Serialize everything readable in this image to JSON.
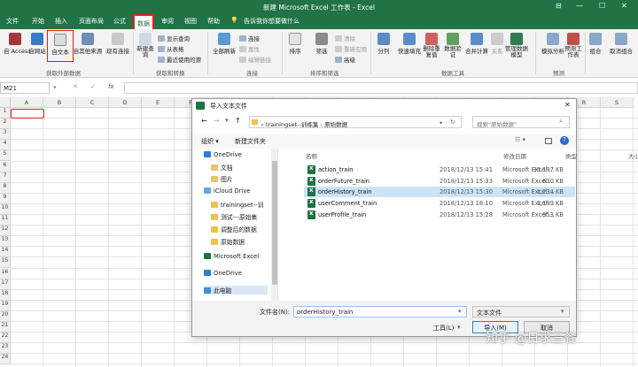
{
  "window": {
    "title": "新建 Microsoft Excel 工作表 - Excel"
  },
  "title_controls": [
    "⊟",
    "—",
    "☐",
    "✕"
  ],
  "ribbon_tabs": [
    "文件",
    "开始",
    "插入",
    "页面布局",
    "公式",
    "数据",
    "审阅",
    "视图",
    "帮助"
  ],
  "tell_me": "告诉我你想要做什么",
  "ribbon": {
    "access": "自 Access",
    "web": "自网站",
    "text": "自文本",
    "other": "自其他来源",
    "existing": "现有连接",
    "new_query": "新建查询",
    "show_queries": "显示查询",
    "from_table": "从表格",
    "recent_sources": "最近使用的源",
    "refresh_all": "全部刷新",
    "connections": "连接",
    "properties": "属性",
    "edit_links": "编辑链接",
    "sort": "排序",
    "filter": "筛选",
    "clear": "清除",
    "reapply": "重新应用",
    "advanced": "高级",
    "split": "分列",
    "flash_fill": "快速填充",
    "remove_dup": "删除重复值",
    "validation": "数据验证",
    "consolidate": "合并计算",
    "relationships": "关系",
    "data_model": "管理数据模型",
    "what_if": "模拟分析",
    "forecast_sheet": "预测工作表",
    "group": "组合",
    "ungroup": "取消组合",
    "group_external": "获取外部数据",
    "group_transform": "获取和转换",
    "group_connections": "连接",
    "group_sort": "排序和筛选",
    "group_tools": "数据工具",
    "group_forecast": "预测"
  },
  "formula_bar": {
    "name_box": "M21",
    "fx": "fx"
  },
  "grid": {
    "columns": [
      "A",
      "B",
      "C",
      "D",
      "E",
      "F",
      "G",
      "H",
      "I",
      "J",
      "K",
      "L",
      "M",
      "N",
      "O",
      "P",
      "Q",
      "R",
      "S"
    ],
    "rows": [
      "1",
      "2",
      "3",
      "4",
      "5",
      "6",
      "7",
      "8",
      "9",
      "10",
      "11",
      "12",
      "13",
      "14",
      "15",
      "16",
      "17",
      "18",
      "19",
      "20",
      "21",
      "22",
      "23",
      "24"
    ]
  },
  "dialog": {
    "title": "导入文本文件",
    "path_parts": [
      "trainingset--训练集",
      "原始数据"
    ],
    "search_placeholder": "搜索\"原始数据\"",
    "organize": "组织 ▾",
    "new_folder": "新建文件夹",
    "nav": [
      {
        "label": "OneDrive",
        "color": "#2b7cd3"
      },
      {
        "label": "文档",
        "color": "#e8c46a"
      },
      {
        "label": "图片",
        "color": "#e8c46a"
      },
      {
        "label": "iCloud Drive",
        "color": "#6aa7e8"
      },
      {
        "label": "trainingset--训",
        "color": "#f0c14b"
      },
      {
        "label": "测试---原始集",
        "color": "#f0c14b"
      },
      {
        "label": "调整后的数据",
        "color": "#f0c14b"
      },
      {
        "label": "原始数据",
        "color": "#f0c14b"
      },
      {
        "label": "Microsoft Excel",
        "color": "#1e7145"
      },
      {
        "label": "OneDrive",
        "color": "#2b7cd3"
      },
      {
        "label": "此电脑",
        "color": "#4a8bd6"
      }
    ],
    "columns": [
      "名称",
      "修改日期",
      "类型",
      "大小"
    ],
    "files": [
      {
        "name": "action_train",
        "date": "2018/12/13 15:41",
        "type": "Microsoft Excel ...",
        "size": "35,197 KB"
      },
      {
        "name": "orderFuture_train",
        "date": "2018/12/13 15:33",
        "type": "Microsoft Excel ...",
        "size": "630 KB"
      },
      {
        "name": "orderHistory_train",
        "date": "2018/12/13 15:30",
        "type": "Microsoft Excel ...",
        "size": "1,234 KB"
      },
      {
        "name": "userComment_train",
        "date": "2018/12/13 18:10",
        "type": "Microsoft Excel ...",
        "size": "1,199 KB"
      },
      {
        "name": "userProfile_train",
        "date": "2018/12/13 15:28",
        "type": "Microsoft Excel ...",
        "size": "953 KB"
      }
    ],
    "filename_label": "文件名(N):",
    "filename_value": "orderHistory_train",
    "filetype_value": "文本文件",
    "tools": "工具(L)",
    "import": "导入(M)",
    "cancel": "取消"
  },
  "watermark": "知乎 @日求三餐",
  "colors": {
    "excel_green": "#217346",
    "highlight_red": "#e0201c",
    "selected_row": "#cce4f7"
  }
}
